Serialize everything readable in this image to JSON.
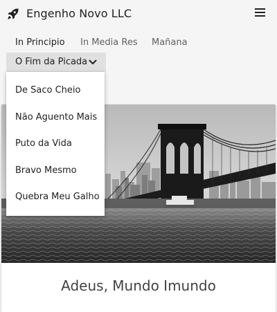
{
  "app": {
    "title": "Engenho Novo LLC",
    "icon": "rocket-icon"
  },
  "nav": {
    "menu_icon": "hamburger-menu-icon",
    "tabs": [
      {
        "label": "In Principio",
        "active": true
      },
      {
        "label": "In Media Res",
        "active": false
      },
      {
        "label": "Mañana",
        "active": false
      }
    ],
    "dropdown": {
      "label": "O Fim da Picada",
      "icon": "chevron-down-icon",
      "expanded": true,
      "items": [
        {
          "label": "De Saco Cheio"
        },
        {
          "label": "Não Aguento Mais"
        },
        {
          "label": "Puto da Vida"
        },
        {
          "label": "Bravo Mesmo"
        },
        {
          "label": "Quebra Meu Galho"
        }
      ]
    }
  },
  "card": {
    "title": "Adeus, Mundo Imundo",
    "image": "brooklyn-bridge-photo"
  },
  "colors": {
    "background": "#f5f5f5",
    "dropdown_tab_bg": "#e0e0e0",
    "text": "#212121",
    "muted_text": "#616161"
  }
}
